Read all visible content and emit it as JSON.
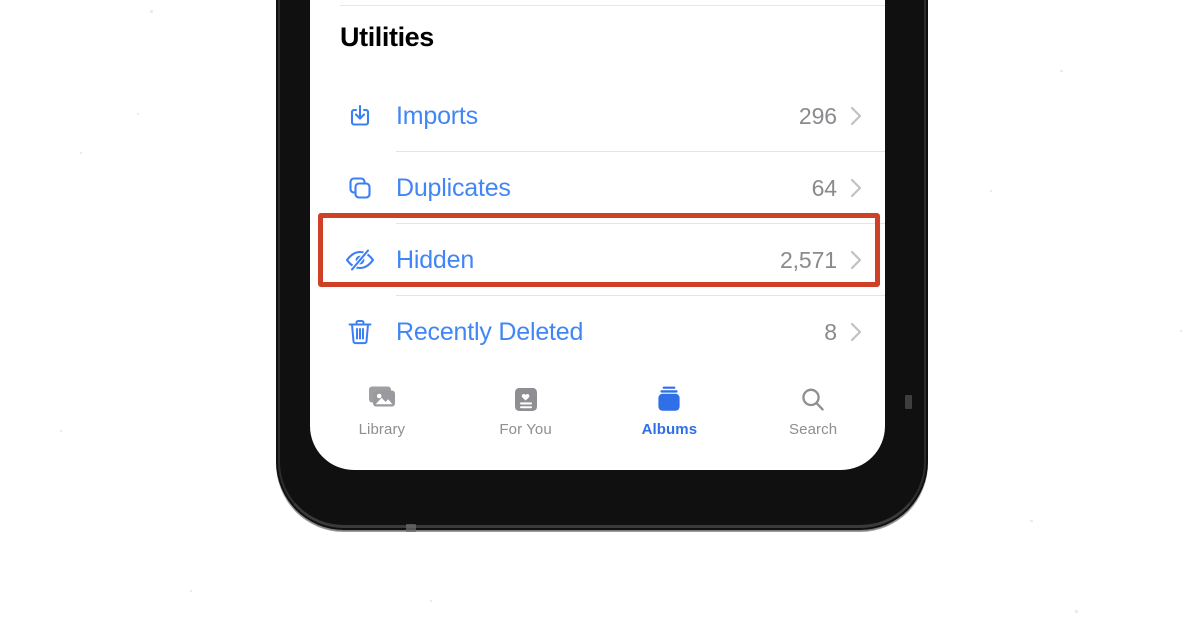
{
  "device": {
    "name": "iphone-frame",
    "bezel_color": "#101010",
    "screen_background": "#ffffff",
    "home_indicator": true
  },
  "screen": {
    "app": "Photos",
    "section": {
      "title": "Utilities",
      "rows": [
        {
          "icon": "import-tray-icon",
          "label": "Imports",
          "count": "296",
          "chevron": "chevron-right-icon",
          "separator": true
        },
        {
          "icon": "duplicates-icon",
          "label": "Duplicates",
          "count": "64",
          "chevron": "chevron-right-icon",
          "separator": true
        },
        {
          "icon": "eye-slash-icon",
          "label": "Hidden",
          "count": "2,571",
          "chevron": "chevron-right-icon",
          "separator": true
        },
        {
          "icon": "trash-icon",
          "label": "Recently Deleted",
          "count": "8",
          "chevron": "chevron-right-icon",
          "separator": false
        }
      ]
    },
    "tab_bar": {
      "tabs": [
        {
          "icon": "photo-stack-icon",
          "label": "Library",
          "active": false
        },
        {
          "icon": "heart-card-icon",
          "label": "For You",
          "active": false
        },
        {
          "icon": "albums-stack-icon",
          "label": "Albums",
          "active": true
        },
        {
          "icon": "magnifier-icon",
          "label": "Search",
          "active": false
        }
      ]
    }
  },
  "annotation": {
    "type": "highlight-box",
    "target": "Hidden",
    "color": "#cf4126"
  },
  "colors": {
    "accent_blue": "#4286f5",
    "tab_active_blue": "#2f6fe8",
    "secondary_gray": "#8a8a8e",
    "chevron_gray": "#c2c2c6",
    "separator_gray": "#e4e4e6",
    "annotation_red": "#cf4126",
    "bezel_black": "#101010"
  }
}
